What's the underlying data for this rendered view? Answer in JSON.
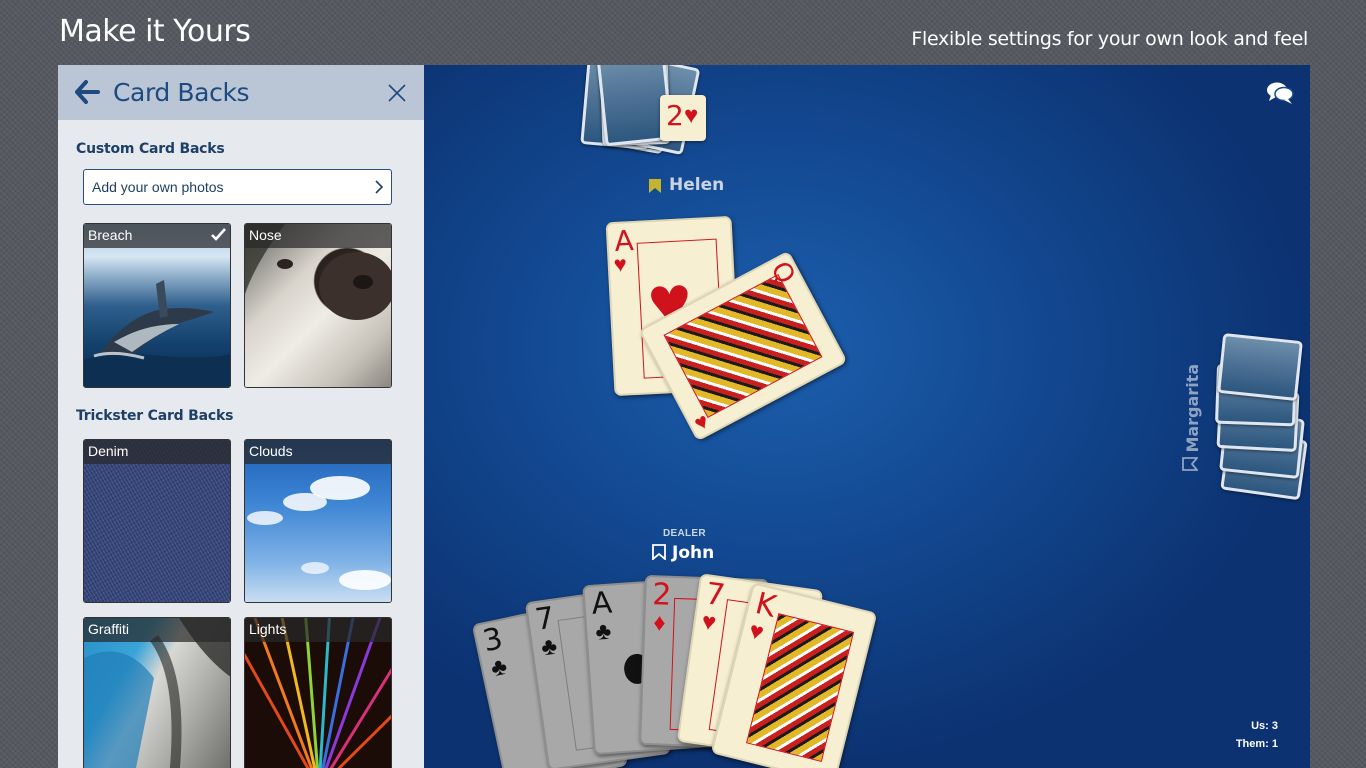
{
  "page": {
    "headline": "Make it Yours",
    "tagline": "Flexible settings for your own look and feel"
  },
  "panel": {
    "title": "Card Backs",
    "custom_section": "Custom Card Backs",
    "add_photos": "Add your own photos",
    "trickster_section": "Trickster Card Backs",
    "custom_backs": [
      {
        "label": "Breach",
        "selected": true
      },
      {
        "label": "Nose",
        "selected": false
      }
    ],
    "trickster_backs": [
      {
        "label": "Denim"
      },
      {
        "label": "Clouds"
      },
      {
        "label": "Graffiti"
      },
      {
        "label": "Lights"
      }
    ]
  },
  "game": {
    "players": {
      "top": "Helen",
      "right": "Margarita",
      "bottom": "John"
    },
    "dealer_label": "DEALER",
    "top_shown_card": {
      "rank": "2",
      "suit": "♥"
    },
    "trick_cards": [
      {
        "rank": "A",
        "suit": "♥"
      },
      {
        "rank": "Q",
        "suit": "♥"
      }
    ],
    "hand": [
      {
        "rank": "3",
        "suit": "♣",
        "playable": false
      },
      {
        "rank": "7",
        "suit": "♣",
        "playable": false
      },
      {
        "rank": "A",
        "suit": "♣",
        "playable": false
      },
      {
        "rank": "2",
        "suit": "♦",
        "playable": false
      },
      {
        "rank": "7",
        "suit": "♥",
        "playable": true
      },
      {
        "rank": "K",
        "suit": "♥",
        "playable": true
      }
    ],
    "score": {
      "us_label": "Us:",
      "us_value": "3",
      "them_label": "Them:",
      "them_value": "1"
    }
  },
  "colors": {
    "panel_header": "#bac6d6",
    "panel_bg": "#e6e9ee",
    "accent": "#1e4a80",
    "table": "#134a93"
  }
}
